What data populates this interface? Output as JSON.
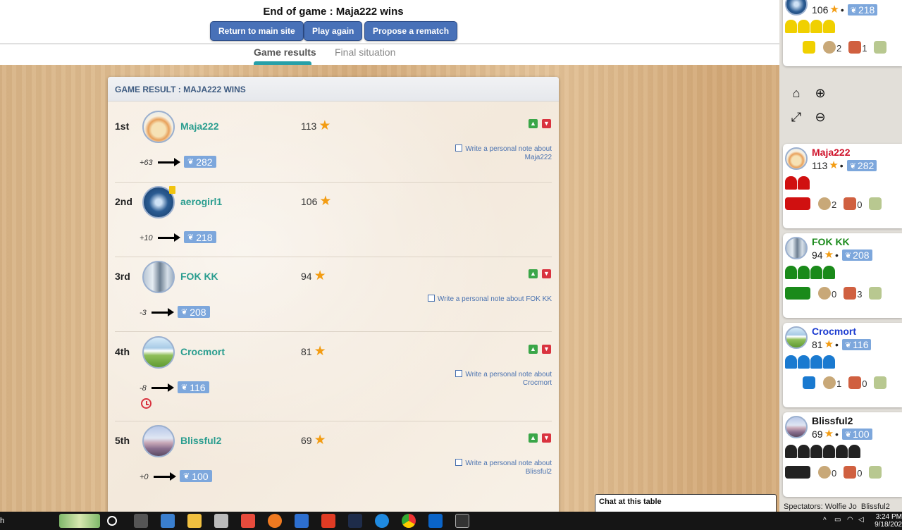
{
  "header": {
    "title": "End of game : Maja222 wins",
    "buttons": [
      "Return to main site",
      "Play again",
      "Propose a rematch"
    ]
  },
  "tabs": [
    "Game results",
    "Final situation"
  ],
  "panel": {
    "title": "GAME RESULT : MAJA222 WINS",
    "rows": [
      {
        "rank": "1st",
        "name": "Maja222",
        "score": "113",
        "delta": "+63",
        "elo": "282",
        "note": "Write a personal note about Maja222"
      },
      {
        "rank": "2nd",
        "name": "aerogirl1",
        "score": "106",
        "delta": "+10",
        "elo": "218",
        "note": ""
      },
      {
        "rank": "3rd",
        "name": "FOK KK",
        "score": "94",
        "delta": "-3",
        "elo": "208",
        "note": "Write a personal note about FOK KK"
      },
      {
        "rank": "4th",
        "name": "Crocmort",
        "score": "81",
        "delta": "-8",
        "elo": "116",
        "note": "Write a personal note about Crocmort"
      },
      {
        "rank": "5th",
        "name": "Blissful2",
        "score": "69",
        "delta": "+0",
        "elo": "100",
        "note": "Write a personal note about Blissful2"
      }
    ]
  },
  "sidebar": {
    "players": [
      {
        "name": "",
        "score": "106",
        "elo": "218",
        "color": "#f0d000",
        "res": [
          "",
          "2",
          "1"
        ]
      },
      {
        "name": "Maja222",
        "score": "113",
        "elo": "282",
        "color": "#d01010",
        "res": [
          "2",
          "0"
        ]
      },
      {
        "name": "FOK KK",
        "score": "94",
        "elo": "208",
        "color": "#1a8a1a",
        "res": [
          "0",
          "3"
        ]
      },
      {
        "name": "Crocmort",
        "score": "81",
        "elo": "116",
        "color": "#1060d0",
        "res": [
          "1",
          "0"
        ]
      },
      {
        "name": "Blissful2",
        "score": "69",
        "elo": "100",
        "color": "#111111",
        "res": [
          "0",
          "0"
        ]
      }
    ]
  },
  "chat": {
    "label": "Chat at this table"
  },
  "spectators": {
    "label": "Spectators:",
    "names": "Wolfie Jo  Blissful2"
  },
  "taskbar": {
    "time": "3:24 PM",
    "date": "9/18/202",
    "left_stub": "h"
  }
}
